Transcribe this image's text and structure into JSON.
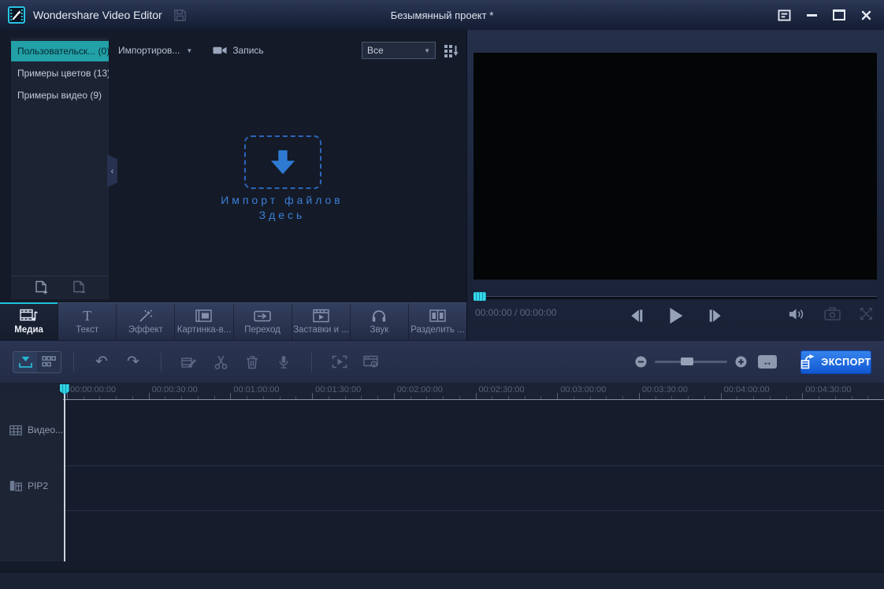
{
  "colors": {
    "accent_teal": "#22a1a7",
    "accent_cyan": "#2fd4e8",
    "accent_blue_import": "#2e7ad1",
    "export_button_blue": "#1a66e0",
    "selected_tab_line": "#1fc3de"
  },
  "titlebar": {
    "app_title": "Wondershare Video Editor",
    "project_title": "Безымянный проект *"
  },
  "sidebar": {
    "items": [
      {
        "label": "Пользовательск... (0)",
        "selected": true
      },
      {
        "label": "Примеры цветов (13)",
        "selected": false
      },
      {
        "label": "Примеры видео (9)",
        "selected": false
      }
    ]
  },
  "media_toolbar": {
    "import_label": "Импортиров...",
    "record_label": "Запись",
    "filter_value": "Все"
  },
  "import_zone": {
    "line1": "Импорт файлов",
    "line2": "Здесь"
  },
  "preview": {
    "timecode": "00:00:00 / 00:00:00"
  },
  "tabs": [
    {
      "label": "Медиа",
      "selected": true
    },
    {
      "label": "Текст",
      "selected": false
    },
    {
      "label": "Эффект",
      "selected": false
    },
    {
      "label": "Картинка-в...",
      "selected": false
    },
    {
      "label": "Переход",
      "selected": false
    },
    {
      "label": "Заставки и ...",
      "selected": false
    },
    {
      "label": "Звук",
      "selected": false
    },
    {
      "label": "Разделить ...",
      "selected": false
    }
  ],
  "toolbar": {
    "export_label": "ЭКСПОРТ"
  },
  "timeline": {
    "ruler_labels": [
      "00:00:00:00",
      "00:00:30:00",
      "00:01:00:00",
      "00:01:30:00",
      "00:02:00:00",
      "00:02:30:00",
      "00:03:00:00",
      "00:03:30:00",
      "00:04:00:00",
      "00:04:30:00"
    ],
    "tracks": [
      {
        "label": "Видео..."
      },
      {
        "label": "PIP2"
      }
    ]
  },
  "glyphs": {
    "caret_down": "▼",
    "undo": "↶",
    "redo": "↷",
    "fit": "↔",
    "collapse": "‹",
    "text_tab_icon": "T"
  }
}
